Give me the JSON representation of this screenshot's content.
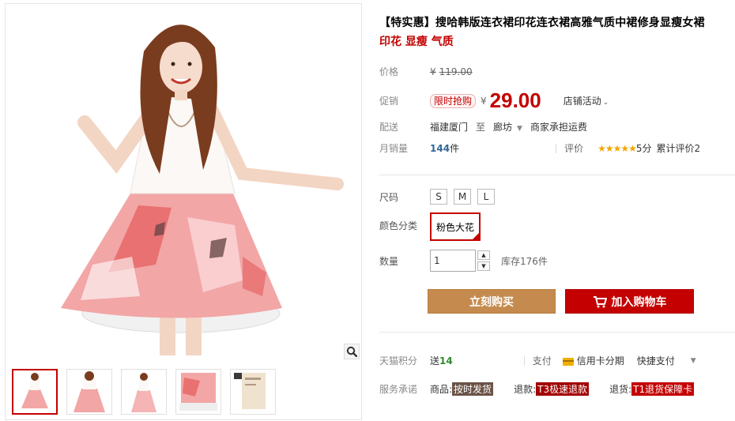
{
  "product": {
    "title": "【特实惠】搜哈韩版连衣裙印花连衣裙高雅气质中裙修身显瘦女裙",
    "subtitle": "印花 显瘦 气质"
  },
  "price": {
    "label": "价格",
    "currency": "¥",
    "original": "119.00"
  },
  "promo": {
    "label": "促销",
    "tag": "限时抢购",
    "currency": "¥",
    "price": "29.00",
    "shop_activity": "店铺活动"
  },
  "shipping": {
    "label": "配送",
    "from": "福建厦门",
    "to_word": "至",
    "destination": "廊坊",
    "fee": "商家承担运费"
  },
  "sales": {
    "label": "月销量",
    "count": "144",
    "unit": "件",
    "review_label": "评价",
    "stars": "★★★★★",
    "score": "5分",
    "cumulative": "累计评价2"
  },
  "options": {
    "size_label": "尺码",
    "sizes": [
      "S",
      "M",
      "L"
    ],
    "color_label": "颜色分类",
    "color_selected": "粉色大花",
    "qty_label": "数量",
    "qty_value": "1",
    "stock": "库存176件"
  },
  "actions": {
    "buy_now": "立刻购买",
    "add_to_cart": "加入购物车"
  },
  "points": {
    "label": "天猫积分",
    "give": "送",
    "amount": "14",
    "pay_label": "支付",
    "credit": "信用卡分期",
    "quick_pay": "快捷支付"
  },
  "service": {
    "label": "服务承诺",
    "goods_prefix": "商品:",
    "goods_tag": "按时发货",
    "refund_prefix": "退款:",
    "refund_tag": "T3极速退款",
    "return_prefix": "退货:",
    "return_tag": "T1退货保障卡"
  },
  "colors": {
    "accent": "#c40000",
    "buy_button": "#c58b4e",
    "stars": "#f0a800"
  }
}
